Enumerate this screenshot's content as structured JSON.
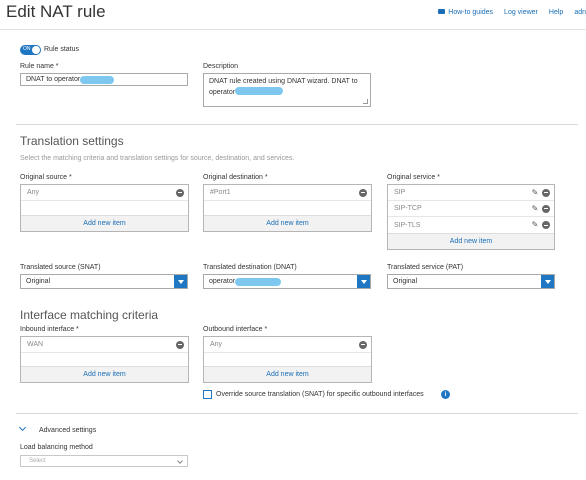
{
  "page": {
    "title": "Edit NAT rule",
    "links": {
      "how_to": "How-to guides",
      "log_viewer": "Log viewer",
      "help": "Help",
      "user": "adn"
    }
  },
  "rule_status": {
    "toggle_text": "ON",
    "label": "Rule status"
  },
  "rule_name": {
    "label": "Rule name *",
    "value": "DNAT to operator"
  },
  "description": {
    "label": "Description",
    "value": "DNAT rule created using DNAT wizard. DNAT to operator"
  },
  "translation": {
    "title": "Translation settings",
    "subtitle": "Select the matching criteria and translation settings for source, destination, and services.",
    "original_source": {
      "label": "Original source *",
      "items": [
        "Any"
      ],
      "add_label": "Add new item"
    },
    "original_destination": {
      "label": "Original destination *",
      "items": [
        "#Port1"
      ],
      "add_label": "Add new item"
    },
    "original_service": {
      "label": "Original service *",
      "items": [
        "SIP",
        "SIP-TCP",
        "SIP-TLS"
      ],
      "add_label": "Add new item"
    },
    "translated_source": {
      "label": "Translated source (SNAT)",
      "value": "Original"
    },
    "translated_destination": {
      "label": "Translated destination (DNAT)",
      "value": "operator"
    },
    "translated_service": {
      "label": "Translated service (PAT)",
      "value": "Original"
    }
  },
  "interface": {
    "title": "Interface matching criteria",
    "inbound": {
      "label": "Inbound interface *",
      "items": [
        "WAN"
      ],
      "add_label": "Add new item"
    },
    "outbound": {
      "label": "Outbound interface *",
      "items": [
        "Any"
      ],
      "add_label": "Add new item"
    },
    "override_label": "Override source translation (SNAT) for specific outbound interfaces",
    "info_glyph": "i"
  },
  "advanced": {
    "label": "Advanced settings",
    "lb_label": "Load balancing method",
    "lb_placeholder": "Select"
  },
  "colors": {
    "accent": "#1f76c2",
    "link": "#1a6eb5",
    "redaction": "#7ec8ef"
  }
}
